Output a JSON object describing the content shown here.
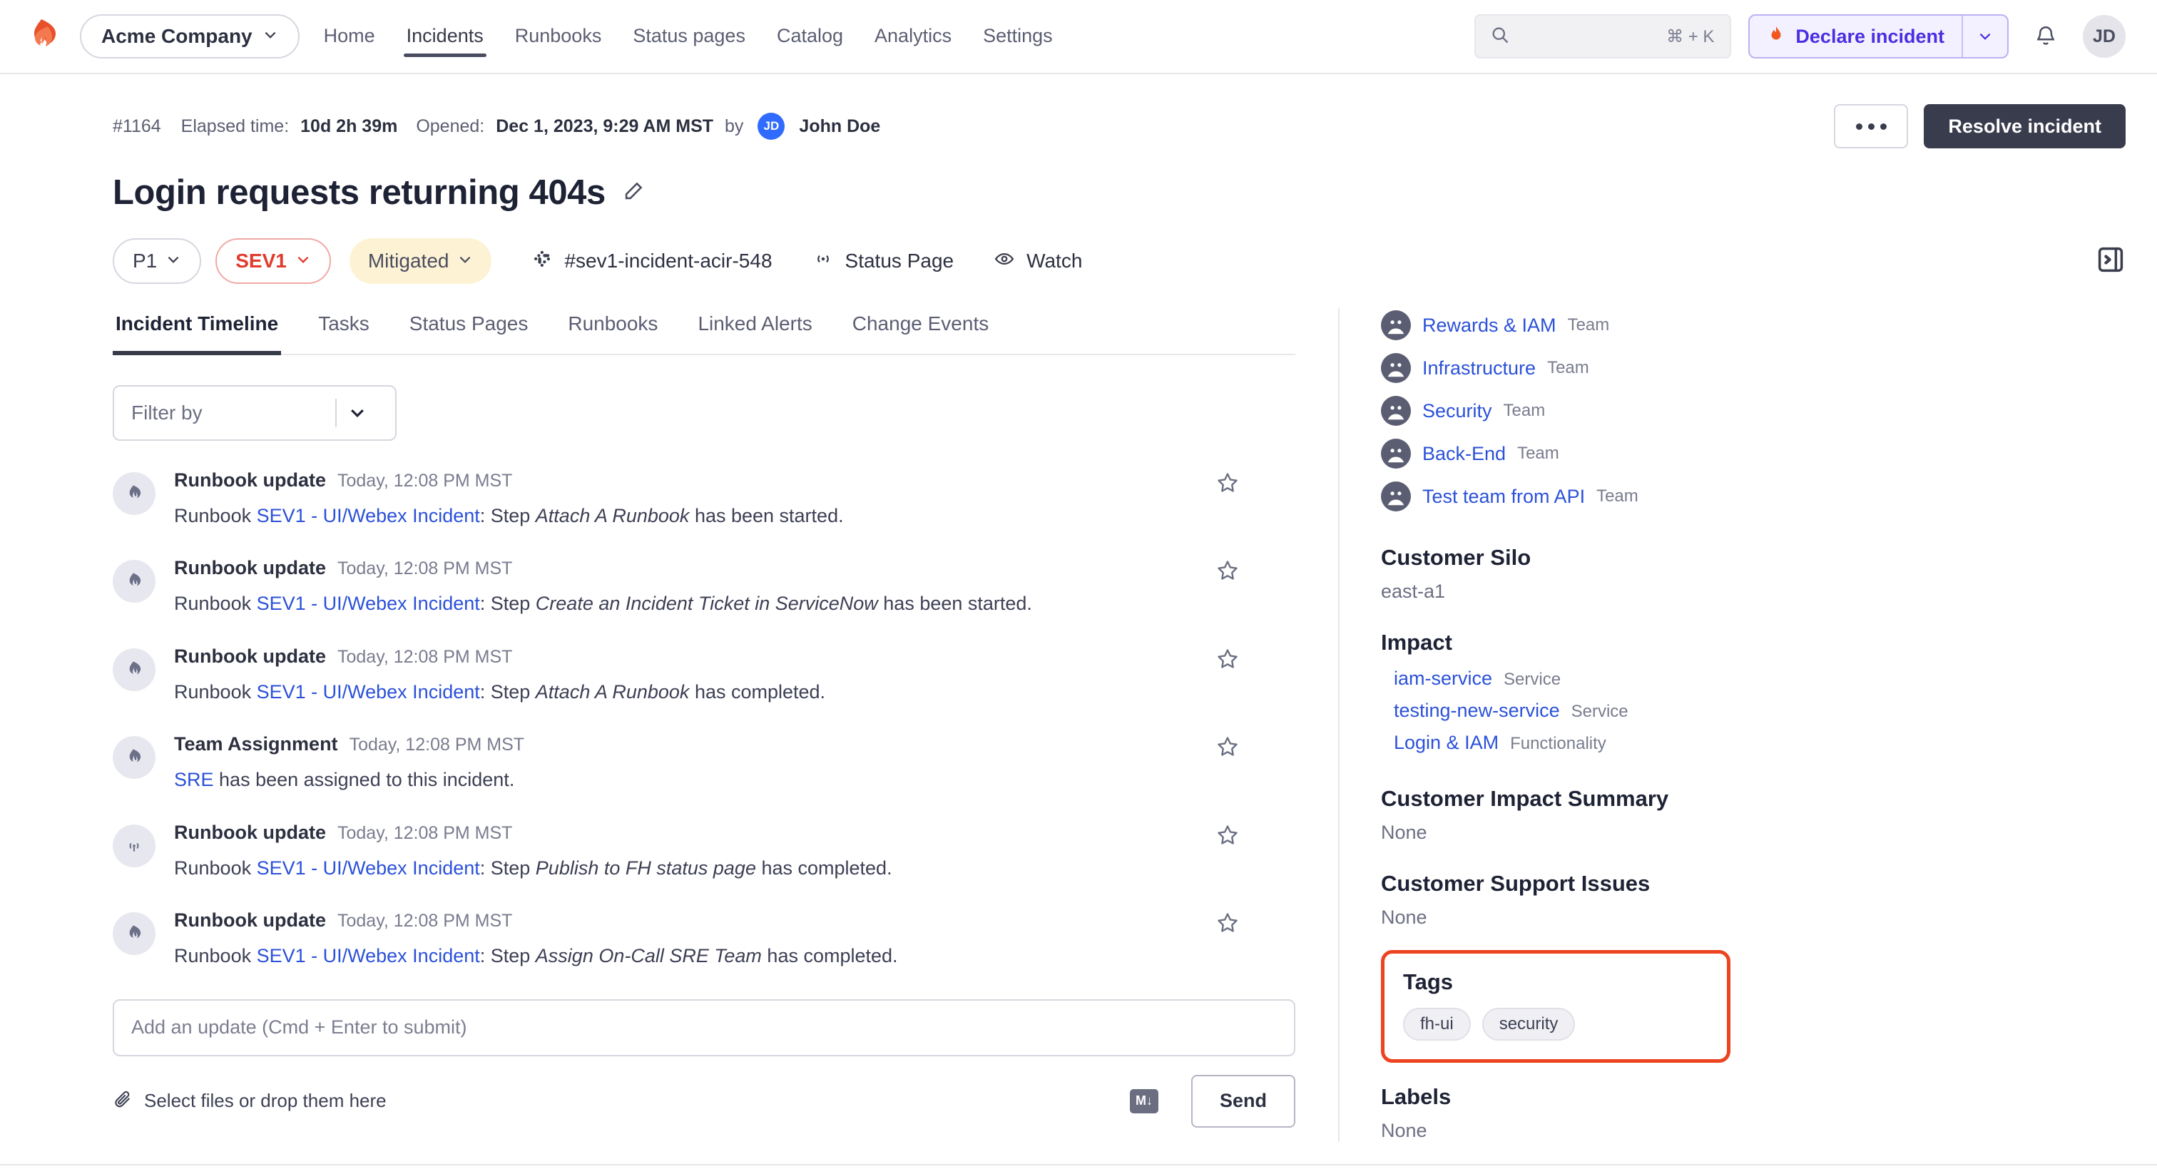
{
  "topnav": {
    "logo_icon": "firehydrant-logo-icon",
    "org": {
      "label": "Acme Company",
      "caret_icon": "chevron-down-icon"
    },
    "links": [
      {
        "label": "Home",
        "active": false
      },
      {
        "label": "Incidents",
        "active": true
      },
      {
        "label": "Runbooks",
        "active": false
      },
      {
        "label": "Status pages",
        "active": false
      },
      {
        "label": "Catalog",
        "active": false
      },
      {
        "label": "Analytics",
        "active": false
      },
      {
        "label": "Settings",
        "active": false
      }
    ],
    "search": {
      "icon": "search-icon",
      "value": "",
      "placeholder": "",
      "shortcut": "⌘ + K"
    },
    "declare": {
      "icon": "flame-icon",
      "label": "Declare incident",
      "caret_icon": "chevron-down-icon"
    },
    "notifications_icon": "bell-icon",
    "avatar": {
      "initials": "JD",
      "name": "avatar"
    }
  },
  "incident": {
    "id": "#1164",
    "elapsed_label": "Elapsed time:",
    "elapsed_value": "10d 2h 39m",
    "opened_label": "Opened:",
    "opened_value": "Dec 1, 2023, 9:29 AM MST",
    "by_label": "by",
    "author_initials": "JD",
    "author_name": "John Doe",
    "more_button": "more-actions",
    "resolve_label": "Resolve incident",
    "title": "Login requests returning 404s",
    "edit_icon": "pencil-icon",
    "chips": [
      {
        "label": "P1",
        "style": "p1",
        "caret_icon": "chevron-down-icon"
      },
      {
        "label": "SEV1",
        "style": "sev1",
        "caret_icon": "chevron-down-icon"
      },
      {
        "label": "Mitigated",
        "style": "mitigated",
        "caret_icon": "chevron-down-icon"
      }
    ],
    "slack_channel": "#sev1-incident-acir-548",
    "slack_icon": "slack-icon",
    "status_page_label": "Status Page",
    "status_page_icon": "broadcast-icon",
    "watch_label": "Watch",
    "watch_icon": "eye-icon",
    "collapse_icon": "collapse-panel-icon"
  },
  "tabs": [
    {
      "label": "Incident Timeline",
      "active": true
    },
    {
      "label": "Tasks",
      "active": false
    },
    {
      "label": "Status Pages",
      "active": false
    },
    {
      "label": "Runbooks",
      "active": false
    },
    {
      "label": "Linked Alerts",
      "active": false
    },
    {
      "label": "Change Events",
      "active": false
    }
  ],
  "filter": {
    "placeholder": "Filter by",
    "value": "",
    "caret_icon": "chevron-down-icon"
  },
  "timeline": [
    {
      "icon": "firehydrant-mark-icon",
      "kind": "Runbook update",
      "time": "Today, 12:08 PM MST",
      "prefix": "Runbook ",
      "link": "SEV1 - UI/Webex Incident",
      "mid": ": Step ",
      "em": "Attach A Runbook",
      "suffix": " has been started.",
      "star_icon": "star-outline-icon"
    },
    {
      "icon": "firehydrant-mark-icon",
      "kind": "Runbook update",
      "time": "Today, 12:08 PM MST",
      "prefix": "Runbook ",
      "link": "SEV1 - UI/Webex Incident",
      "mid": ": Step ",
      "em": "Create an Incident Ticket in ServiceNow",
      "suffix": " has been started.",
      "star_icon": "star-outline-icon"
    },
    {
      "icon": "firehydrant-mark-icon",
      "kind": "Runbook update",
      "time": "Today, 12:08 PM MST",
      "prefix": "Runbook ",
      "link": "SEV1 - UI/Webex Incident",
      "mid": ": Step ",
      "em": "Attach A Runbook",
      "suffix": " has completed.",
      "star_icon": "star-outline-icon"
    },
    {
      "icon": "firehydrant-mark-icon",
      "kind": "Team Assignment",
      "time": "Today, 12:08 PM MST",
      "prefix": "",
      "link": "SRE",
      "mid": "",
      "em": "",
      "suffix": " has been assigned to this incident.",
      "star_icon": "star-outline-icon"
    },
    {
      "icon": "broadcast-icon",
      "kind": "Runbook update",
      "time": "Today, 12:08 PM MST",
      "prefix": "Runbook ",
      "link": "SEV1 - UI/Webex Incident",
      "mid": ": Step ",
      "em": "Publish to FH status page",
      "suffix": " has completed.",
      "star_icon": "star-outline-icon"
    },
    {
      "icon": "firehydrant-mark-icon",
      "kind": "Runbook update",
      "time": "Today, 12:08 PM MST",
      "prefix": "Runbook ",
      "link": "SEV1 - UI/Webex Incident",
      "mid": ": Step ",
      "em": "Assign On-Call SRE Team",
      "suffix": " has completed.",
      "star_icon": "star-outline-icon"
    }
  ],
  "composer": {
    "placeholder": "Add an update (Cmd + Enter to submit)",
    "value": "",
    "attach_icon": "paperclip-icon",
    "attach_label": "Select files or drop them here",
    "markdown_badge": "M↓",
    "send_label": "Send"
  },
  "sidebar": {
    "responders": [
      {
        "name": "Rewards & IAM",
        "role": "Team",
        "avatar_icon": "team-avatar-icon"
      },
      {
        "name": "Infrastructure",
        "role": "Team",
        "avatar_icon": "team-avatar-icon"
      },
      {
        "name": "Security",
        "role": "Team",
        "avatar_icon": "team-avatar-icon"
      },
      {
        "name": "Back-End",
        "role": "Team",
        "avatar_icon": "team-avatar-icon"
      },
      {
        "name": "Test team from API",
        "role": "Team",
        "avatar_icon": "team-avatar-icon"
      }
    ],
    "customer_silo": {
      "title": "Customer Silo",
      "value": "east-a1"
    },
    "impact": {
      "title": "Impact",
      "items": [
        {
          "name": "iam-service",
          "kind": "Service"
        },
        {
          "name": "testing-new-service",
          "kind": "Service"
        },
        {
          "name": "Login & IAM",
          "kind": "Functionality"
        }
      ]
    },
    "customer_impact_summary": {
      "title": "Customer Impact Summary",
      "value": "None"
    },
    "customer_support_issues": {
      "title": "Customer Support Issues",
      "value": "None"
    },
    "tags": {
      "title": "Tags",
      "items": [
        "fh-ui",
        "security"
      ],
      "highlight_color": "#ec4420"
    },
    "labels": {
      "title": "Labels",
      "value": "None"
    }
  }
}
